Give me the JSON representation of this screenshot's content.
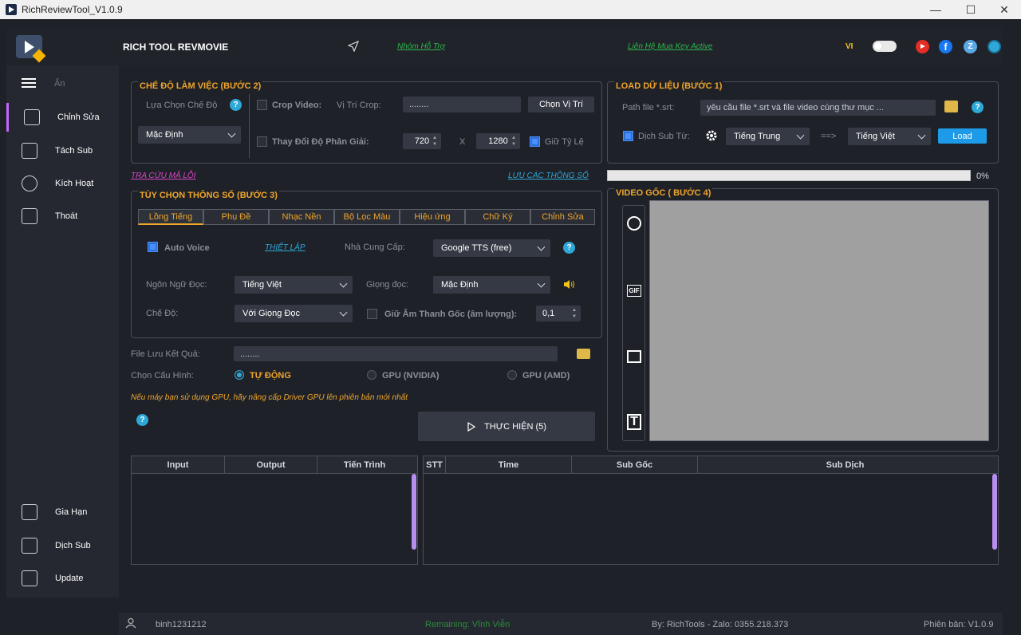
{
  "window": {
    "title": "RichReviewTool_V1.0.9",
    "minimize": "—",
    "maximize": "☐",
    "close": "✕"
  },
  "topbar": {
    "brand": "RICH TOOL REVMOVIE",
    "support_link": "Nhóm Hỗ Trợ",
    "buy_link": "Liên Hệ Mua Key Active",
    "lang": "VI"
  },
  "sidebar": {
    "hide_label": "Ẩn",
    "items": [
      {
        "label": "Chỉnh Sửa",
        "icon": "edit-video-icon"
      },
      {
        "label": "Tách Sub",
        "icon": "document-icon"
      },
      {
        "label": "Kích Hoạt",
        "icon": "user-key-icon"
      },
      {
        "label": "Thoát",
        "icon": "exit-icon"
      }
    ],
    "bottom_items": [
      {
        "label": "Gia Hạn",
        "icon": "wallet-icon"
      },
      {
        "label": "Dịch Sub",
        "icon": "translate-icon"
      },
      {
        "label": "Update",
        "icon": "update-icon"
      }
    ]
  },
  "work_mode": {
    "title": "CHẾ ĐỘ LÀM VIỆC (BƯỚC 2)",
    "choose_label": "Lựa Chọn Chế Độ",
    "mode_value": "Mặc Định",
    "crop_label": "Crop Video:",
    "crop_pos_label": "Vị Trí Crop:",
    "crop_pos_value": "........",
    "choose_pos_button": "Chọn Vị Trí",
    "resize_label": "Thay Đổi Độ Phân Giải:",
    "width": "720",
    "x": "X",
    "height": "1280",
    "keep_ratio": "Giữ Tỷ Lệ"
  },
  "load_data": {
    "title": "LOAD DỮ LIỆU (BƯỚC 1)",
    "path_label": "Path file *.srt:",
    "path_placeholder": "yêu cầu file *.srt và file video cùng thư mục ...",
    "translate_label": "Dịch Sub Từ:",
    "from_lang": "Tiếng Trung",
    "arrow": "==>",
    "to_lang": "Tiếng Việt",
    "load_button": "Load",
    "progress_text": "0%",
    "progress_value": 0
  },
  "links": {
    "error_lookup": "TRA CỨU MÃ LỖI",
    "save_params": "LƯU CÁC THÔNG SỐ"
  },
  "options": {
    "title": "TÙY CHỌN THÔNG SỐ (BƯỚC 3)",
    "tabs": [
      "Lồng Tiếng",
      "Phụ Đề",
      "Nhạc Nền",
      "Bộ Lọc Màu",
      "Hiệu ứng",
      "Chữ Ký",
      "Chỉnh Sửa"
    ],
    "auto_voice": "Auto Voice",
    "setup_link": "THIẾT LẬP",
    "provider_label": "Nhà Cung Cấp:",
    "provider_value": "Google TTS  (free)",
    "read_lang_label": "Ngôn Ngữ Đọc:",
    "read_lang_value": "Tiếng Việt",
    "voice_label": "Giọng đọc:",
    "voice_value": "Mặc Định",
    "mode_label": "Chế Độ:",
    "mode_value": "Với Giọng Đọc",
    "keep_audio_label": "Giữ Âm Thanh Gốc (âm lượng):",
    "keep_audio_value": "0,1"
  },
  "output": {
    "file_label": "File Lưu Kết Quả:",
    "file_value": "........",
    "config_label": "Chọn Cấu Hình:",
    "radio_auto": "TỰ ĐỘNG",
    "radio_nvidia": "GPU (NVIDIA)",
    "radio_amd": "GPU (AMD)",
    "note": "Nếu máy bạn sử dụng GPU, hãy nâng cấp Driver GPU lên phiên bản mới nhất",
    "run_button": "THỰC HIỆN (5)"
  },
  "video": {
    "title": "VIDEO GỐC ( BƯỚC 4)"
  },
  "table_left": {
    "headers": [
      "Input",
      "Output",
      "Tiến Trình"
    ]
  },
  "table_right": {
    "headers": [
      "STT",
      "Time",
      "Sub Gốc",
      "Sub Dịch"
    ]
  },
  "footer": {
    "user": "binh1231212",
    "remaining": "Remaining: Vĩnh Viễn",
    "by": "By: RichTools - Zalo: 0355.218.373",
    "version": "Phiên bản: V1.0.9"
  },
  "colors": {
    "accent": "#f0a52b",
    "link_green": "#2db84b",
    "link_blue": "#2ea8d8",
    "link_pink": "#d946c7",
    "load_button": "#1e9be8",
    "scroll": "#b68ef0"
  }
}
